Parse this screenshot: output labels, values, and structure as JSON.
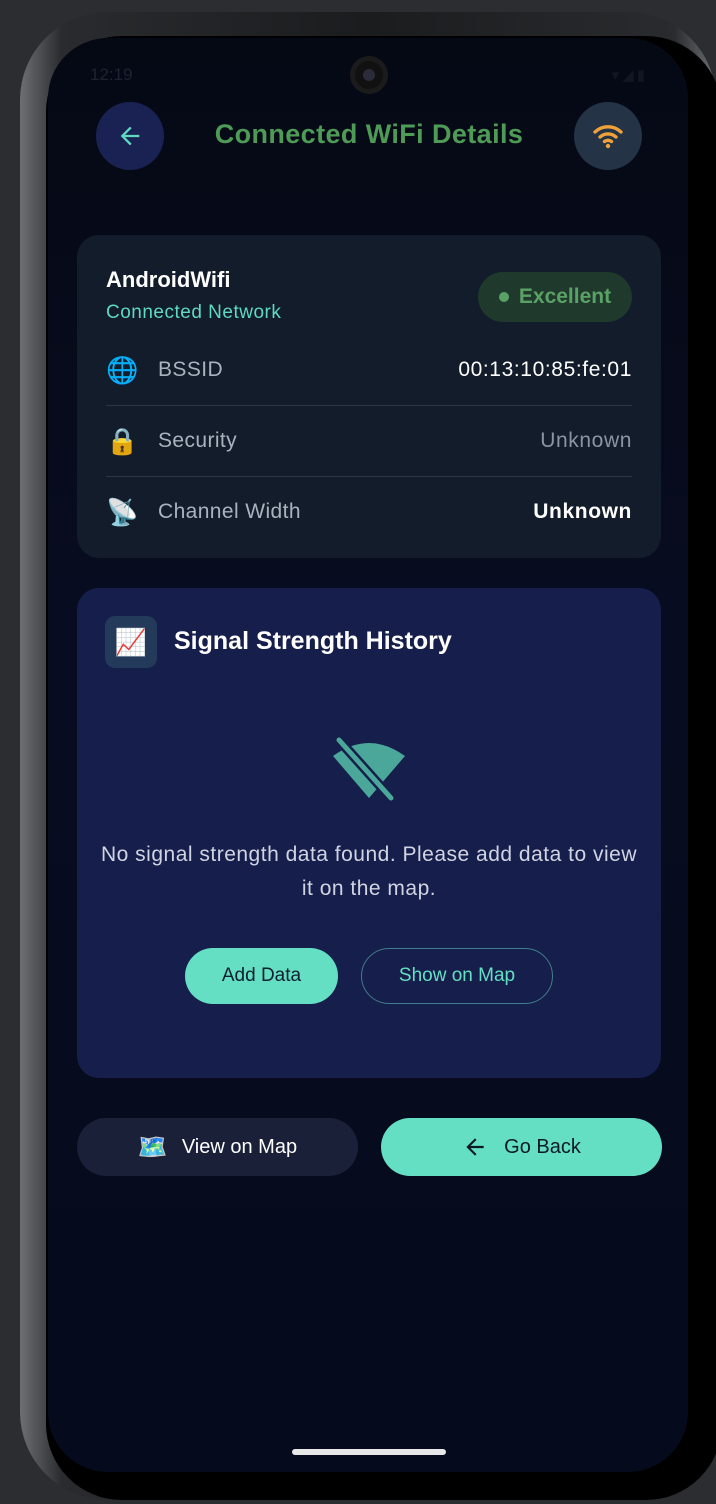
{
  "status_bar": {
    "time": "12:19",
    "icons": "▾◢▮"
  },
  "header": {
    "title": "Connected WiFi Details",
    "back_icon": "arrow-left-icon",
    "wifi_icon": "wifi-icon",
    "wifi_color": "#f0a23a"
  },
  "network": {
    "name": "AndroidWifi",
    "subtitle": "Connected Network",
    "quality": "Excellent",
    "details": [
      {
        "icon": "🌐",
        "label": "BSSID",
        "value": "00:13:10:85:fe:01"
      },
      {
        "icon": "🔒",
        "label": "Security",
        "value": "Unknown"
      },
      {
        "icon": "📡",
        "label": "Channel Width",
        "value": "Unknown"
      }
    ]
  },
  "signal_history": {
    "icon": "📈",
    "title": "Signal Strength History",
    "empty_message": "No signal strength data found. Please add data to view it on the map.",
    "add_button": "Add Data",
    "map_button": "Show on Map"
  },
  "footer": {
    "view_map_icon": "🗺️",
    "view_map_label": "View on Map",
    "go_back_label": "Go Back"
  },
  "colors": {
    "accent": "#64dfc4",
    "title": "#4e9a57",
    "excellent": "#5aa166"
  }
}
